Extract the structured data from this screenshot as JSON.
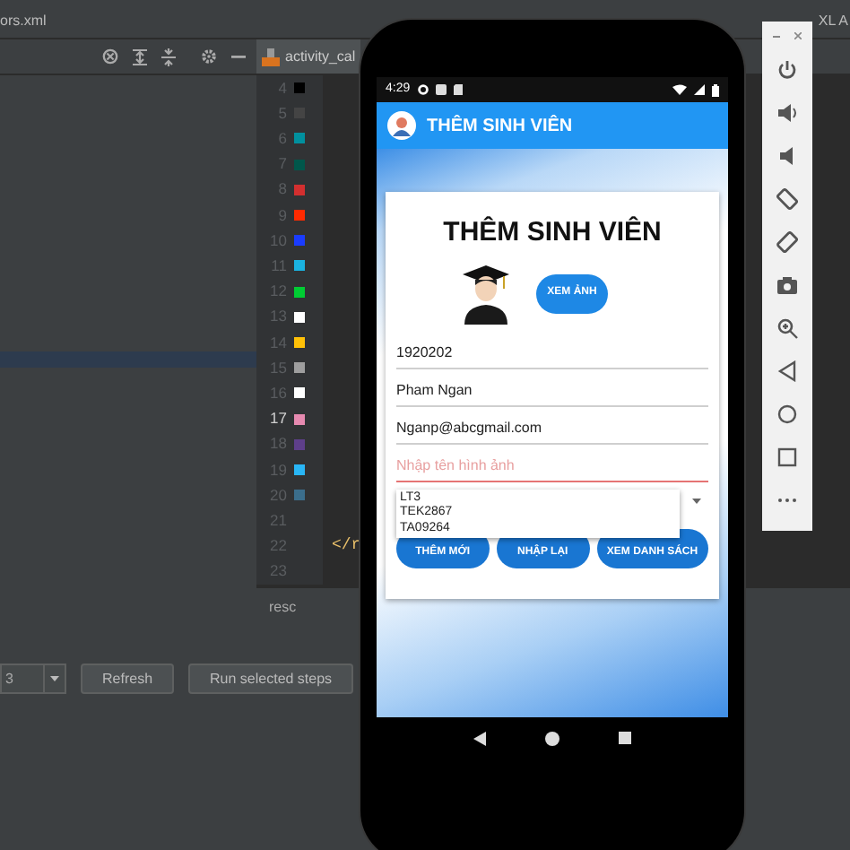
{
  "ide": {
    "file_tab": "ors.xml",
    "right_tab": "XL A",
    "editor_tab": "activity_cal",
    "gutter": [
      {
        "line": "4",
        "color": "#000000",
        "current": false
      },
      {
        "line": "5",
        "color": "#444444",
        "current": false
      },
      {
        "line": "6",
        "color": "#00909e",
        "current": false
      },
      {
        "line": "7",
        "color": "#00574b",
        "current": false
      },
      {
        "line": "8",
        "color": "#d32f2f",
        "current": false
      },
      {
        "line": "9",
        "color": "#ff2a00",
        "current": false
      },
      {
        "line": "10",
        "color": "#1a3cff",
        "current": false
      },
      {
        "line": "11",
        "color": "#1ab2e0",
        "current": false
      },
      {
        "line": "12",
        "color": "#00cc33",
        "current": false
      },
      {
        "line": "13",
        "color": "#ffffff",
        "current": false
      },
      {
        "line": "14",
        "color": "#ffc107",
        "current": false
      },
      {
        "line": "15",
        "color": "#9e9e9e",
        "current": false
      },
      {
        "line": "16",
        "color": "#ffffff",
        "current": false
      },
      {
        "line": "17",
        "color": "#e68ab0",
        "current": true
      },
      {
        "line": "18",
        "color": "#5e3f8a",
        "current": false
      },
      {
        "line": "19",
        "color": "#29b6f6",
        "current": false
      },
      {
        "line": "20",
        "color": "#3b6e8c",
        "current": false
      },
      {
        "line": "21",
        "current": false
      },
      {
        "line": "22",
        "code": "</r",
        "current": false
      },
      {
        "line": "23",
        "current": false
      }
    ],
    "bottom_tab": "resc",
    "bottom_toolbar": {
      "dropdown_value": "3",
      "buttons": [
        "Refresh",
        "Run selected steps"
      ]
    }
  },
  "phone": {
    "status_time": "4:29",
    "app_title": "THÊM SINH VIÊN",
    "card": {
      "heading": "THÊM SINH VIÊN",
      "view_image_button": "XEM ẢNH",
      "fields": [
        {
          "value": "1920202",
          "error": false
        },
        {
          "value": "Pham Ngan",
          "error": false
        },
        {
          "value": "Nganp@abcgmail.com",
          "error": false
        },
        {
          "placeholder": "Nhập tên hình ảnh",
          "error": true
        }
      ],
      "spinner": {
        "expanded": true,
        "options": [
          "LT3",
          "TEK2867",
          "TA09264"
        ]
      },
      "buttons": [
        "THÊM MỚI",
        "NHẬP LẠI",
        "XEM DANH SÁCH"
      ]
    }
  }
}
